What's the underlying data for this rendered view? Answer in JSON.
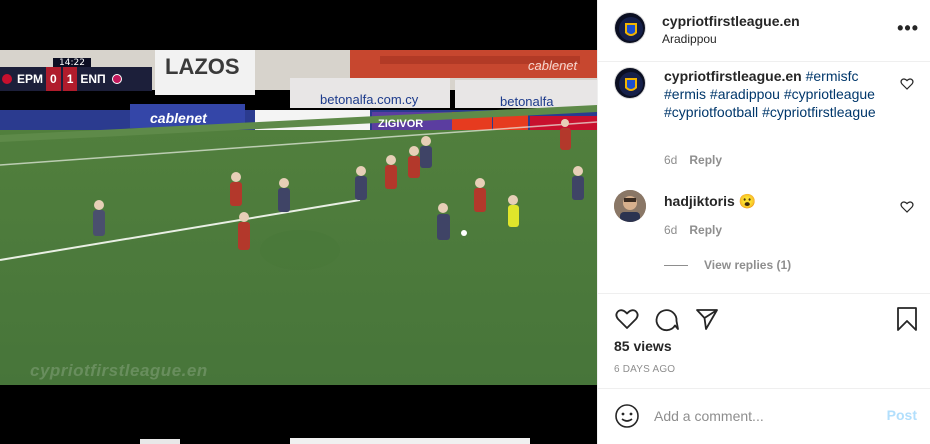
{
  "video": {
    "scoreboard": {
      "clock": "14:22",
      "home_team": "ΕΡΜ",
      "home_score": "0",
      "away_score": "1",
      "away_team": "ΕΝΠ"
    },
    "ads": [
      "LAZOS",
      "betonalfa.com.cy",
      "betonalfa",
      "cablenet",
      "cablenet",
      "ZIGIVOR"
    ],
    "watermark": "cypriotfirstleague.en"
  },
  "post": {
    "username": "cypriotfirstleague.en",
    "location": "Aradippou",
    "more_label": "•••"
  },
  "comments": [
    {
      "username": "cypriotfirstleague.en",
      "hashtags": [
        "#ermisfc",
        "#ermis",
        "#aradippou",
        "#cypriotleague",
        "#cypriotfootball",
        "#cypriotfirstleague"
      ],
      "time": "6d",
      "reply_label": "Reply"
    },
    {
      "username": "hadjiktoris",
      "text": "😮",
      "time": "6d",
      "reply_label": "Reply",
      "view_replies": "View replies (1)"
    }
  ],
  "actions": {
    "icons": [
      "heart-icon",
      "comment-icon",
      "share-icon",
      "bookmark-icon"
    ],
    "views": "85 views",
    "time_ago": "6 DAYS AGO"
  },
  "add_comment": {
    "placeholder": "Add a comment...",
    "post_label": "Post"
  },
  "colors": {
    "link": "#00376b",
    "muted": "#8e8e8e",
    "post_disabled": "#b2dffc",
    "pitch": "#4c7a3a"
  }
}
